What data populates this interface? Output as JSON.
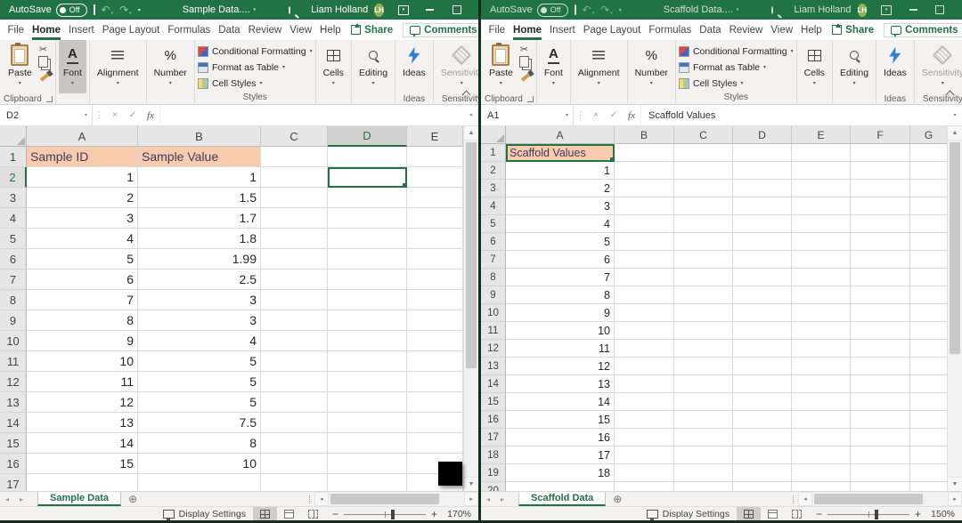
{
  "colors": {
    "titlebar_green": "#217346",
    "ribbon_bg": "#f3f2f1",
    "header_cell_fill": "#f8cbad",
    "header_cell_text": "#3f3a60",
    "selection_green": "#217346",
    "ideas_blue": "#2f7ed8",
    "avatar_green": "#93b053"
  },
  "windows": [
    {
      "inactive": false,
      "titlebar": {
        "autosave_label": "AutoSave",
        "autosave_state": "Off",
        "title": "Sample Data....",
        "user_name": "Liam Holland",
        "user_initials": "LH"
      },
      "menu": {
        "tabs": [
          "File",
          "Home",
          "Insert",
          "Page Layout",
          "Formulas",
          "Data",
          "Review",
          "View",
          "Help"
        ],
        "active_tab": "Home",
        "share_label": "Share",
        "comments_label": "Comments"
      },
      "ribbon": {
        "paste_label": "Paste",
        "font_label": "Font",
        "alignment_label": "Alignment",
        "number_label": "Number",
        "conditional_formatting_label": "Conditional Formatting",
        "format_as_table_label": "Format as Table",
        "cell_styles_label": "Cell Styles",
        "cells_label": "Cells",
        "editing_label": "Editing",
        "ideas_label": "Ideas",
        "sensitivity_label": "Sensitivity",
        "group_clipboard": "Clipboard",
        "group_styles": "Styles",
        "group_ideas": "Ideas",
        "group_sensitivity": "Sensitivity",
        "font_highlighted": true
      },
      "formula_bar": {
        "name_box": "D2",
        "formula": ""
      },
      "grid": {
        "columns": [
          "A",
          "B",
          "C",
          "D",
          "E"
        ],
        "selected_column": "D",
        "selected_row": 2,
        "selected_cell": "D2",
        "header_cells": [
          "Sample ID",
          "Sample Value"
        ],
        "rows": [
          [
            "1",
            "1"
          ],
          [
            "2",
            "1.5"
          ],
          [
            "3",
            "1.7"
          ],
          [
            "4",
            "1.8"
          ],
          [
            "5",
            "1.99"
          ],
          [
            "6",
            "2.5"
          ],
          [
            "7",
            "3"
          ],
          [
            "8",
            "3"
          ],
          [
            "9",
            "4"
          ],
          [
            "10",
            "5"
          ],
          [
            "11",
            "5"
          ],
          [
            "12",
            "5"
          ],
          [
            "13",
            "7.5"
          ],
          [
            "14",
            "8"
          ],
          [
            "15",
            "10"
          ]
        ]
      },
      "sheet_tab": "Sample Data",
      "status_bar": {
        "display_settings_label": "Display Settings",
        "zoom_level": "170%"
      },
      "black_box": true
    },
    {
      "inactive": true,
      "titlebar": {
        "autosave_label": "AutoSave",
        "autosave_state": "Off",
        "title": "Scaffold Data....",
        "user_name": "Liam Holland",
        "user_initials": "LH"
      },
      "menu": {
        "tabs": [
          "File",
          "Home",
          "Insert",
          "Page Layout",
          "Formulas",
          "Data",
          "Review",
          "View",
          "Help"
        ],
        "active_tab": "Home",
        "share_label": "Share",
        "comments_label": "Comments"
      },
      "ribbon": {
        "paste_label": "Paste",
        "font_label": "Font",
        "alignment_label": "Alignment",
        "number_label": "Number",
        "conditional_formatting_label": "Conditional Formatting",
        "format_as_table_label": "Format as Table",
        "cell_styles_label": "Cell Styles",
        "cells_label": "Cells",
        "editing_label": "Editing",
        "ideas_label": "Ideas",
        "sensitivity_label": "Sensitivity",
        "group_clipboard": "Clipboard",
        "group_styles": "Styles",
        "group_ideas": "Ideas",
        "group_sensitivity": "Sensitivity",
        "font_highlighted": false
      },
      "formula_bar": {
        "name_box": "A1",
        "formula": "Scaffold Values"
      },
      "grid": {
        "columns": [
          "A",
          "B",
          "C",
          "D",
          "E",
          "F",
          "G"
        ],
        "selected_cell": "A1",
        "header_cells": [
          "Scaffold Values"
        ],
        "rows": [
          [
            "1"
          ],
          [
            "2"
          ],
          [
            "3"
          ],
          [
            "4"
          ],
          [
            "5"
          ],
          [
            "6"
          ],
          [
            "7"
          ],
          [
            "8"
          ],
          [
            "9"
          ],
          [
            "10"
          ],
          [
            "11"
          ],
          [
            "12"
          ],
          [
            "13"
          ],
          [
            "14"
          ],
          [
            "15"
          ],
          [
            "16"
          ],
          [
            "17"
          ],
          [
            "18"
          ]
        ]
      },
      "sheet_tab": "Scaffold Data",
      "status_bar": {
        "display_settings_label": "Display Settings",
        "zoom_level": "150%"
      },
      "black_box": false
    }
  ]
}
